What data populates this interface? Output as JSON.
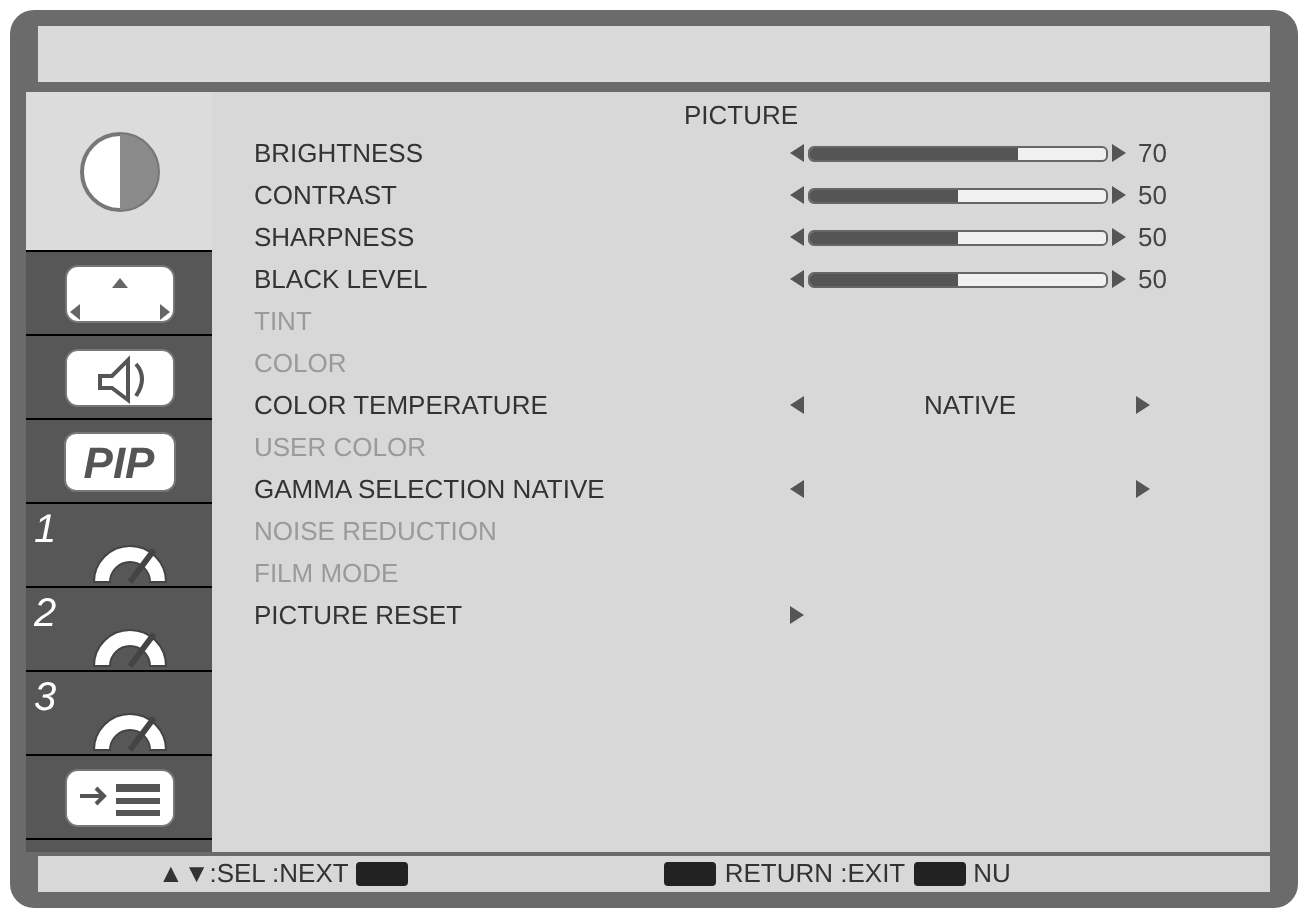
{
  "sidebar": {
    "items": [
      {
        "kind": "picture",
        "selected": true
      },
      {
        "kind": "screen",
        "selected": false
      },
      {
        "kind": "audio",
        "selected": false
      },
      {
        "kind": "pip",
        "label": "PIP",
        "selected": false
      },
      {
        "kind": "config",
        "label": "1",
        "selected": false
      },
      {
        "kind": "config",
        "label": "2",
        "selected": false
      },
      {
        "kind": "config",
        "label": "3",
        "selected": false
      },
      {
        "kind": "advanced",
        "selected": false
      }
    ]
  },
  "menu": {
    "title": "PICTURE",
    "rows": [
      {
        "kind": "slider",
        "label": "BRIGHTNESS",
        "level": 0.7,
        "reading": "70",
        "disabled": false
      },
      {
        "kind": "slider",
        "label": "CONTRAST",
        "level": 0.5,
        "reading": "50",
        "disabled": false
      },
      {
        "kind": "slider",
        "label": "SHARPNESS",
        "level": 0.5,
        "reading": "50",
        "disabled": false
      },
      {
        "kind": "slider",
        "label": "BLACK LEVEL",
        "level": 0.5,
        "reading": "50",
        "disabled": false
      },
      {
        "kind": "text",
        "label": "TINT",
        "disabled": true
      },
      {
        "kind": "text",
        "label": "COLOR",
        "disabled": true
      },
      {
        "kind": "select",
        "label": "COLOR TEMPERATURE",
        "value": "NATIVE",
        "disabled": false
      },
      {
        "kind": "text",
        "label": "USER COLOR",
        "disabled": true
      },
      {
        "kind": "select",
        "label": "GAMMA SELECTION NATIVE",
        "disabled": false
      },
      {
        "kind": "text",
        "label": "NOISE REDUCTION",
        "disabled": true
      },
      {
        "kind": "text",
        "label": "FILM MODE",
        "disabled": true
      },
      {
        "kind": "submenu",
        "label": "PICTURE RESET",
        "disabled": false
      }
    ]
  },
  "footer": {
    "hints": [
      {
        "kind": "text",
        "text": "▲▼:SEL :NEXT"
      },
      {
        "kind": "key"
      },
      {
        "kind": "gap"
      },
      {
        "kind": "key"
      },
      {
        "kind": "text",
        "text": "RETURN :EXIT"
      },
      {
        "kind": "key"
      },
      {
        "kind": "text",
        "text": "NU"
      }
    ]
  }
}
